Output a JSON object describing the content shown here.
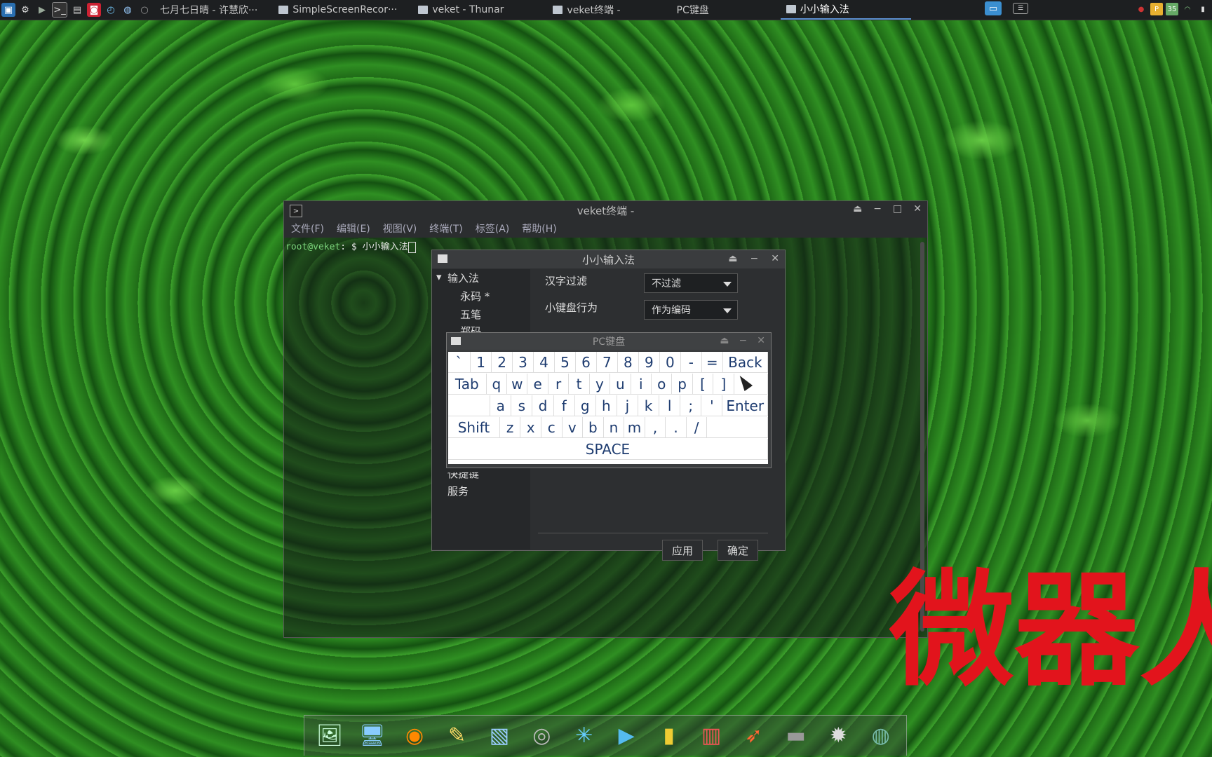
{
  "taskbar": {
    "launcher_icons": [
      "app-menu-icon",
      "settings-icon",
      "play-icon",
      "terminal-icon",
      "floppy-icon",
      "screen-icon",
      "clock-icon",
      "globe-icon"
    ],
    "tasks": [
      {
        "label": "七月七日晴 - 许慧欣···",
        "active": false
      },
      {
        "label": "SimpleScreenRecor···",
        "active": false
      },
      {
        "label": "veket - Thunar",
        "active": false
      },
      {
        "label": "veket终端 -",
        "active": false
      },
      {
        "label": "PC键盘",
        "active": false
      },
      {
        "label": "小小输入法",
        "active": true
      }
    ],
    "battery": "35"
  },
  "terminal": {
    "title": "veket终端 -",
    "menu": [
      "文件(F)",
      "编辑(E)",
      "视图(V)",
      "终端(T)",
      "标签(A)",
      "帮助(H)"
    ],
    "prompt_user": "root@veket",
    "prompt_rest": ": $ 小小输入法"
  },
  "ime": {
    "title": "小小输入法",
    "tree": {
      "root": "输入法",
      "items": [
        "永码 *",
        "五笔",
        "郑码"
      ],
      "bottom_partial": "快捷键",
      "bottom": "服务"
    },
    "settings": [
      {
        "label": "汉字过滤",
        "value": "不过滤"
      },
      {
        "label": "小键盘行为",
        "value": "作为编码"
      }
    ],
    "apply_label": "应用",
    "ok_label": "确定"
  },
  "keyboard": {
    "title": "PC键盘",
    "rows": [
      [
        "`",
        "1",
        "2",
        "3",
        "4",
        "5",
        "6",
        "7",
        "8",
        "9",
        "0",
        "-",
        "=",
        "Back"
      ],
      [
        "Tab",
        "q",
        "w",
        "e",
        "r",
        "t",
        "y",
        "u",
        "i",
        "o",
        "p",
        "[",
        "]",
        ""
      ],
      [
        "",
        "a",
        "s",
        "d",
        "f",
        "g",
        "h",
        "j",
        "k",
        "l",
        ";",
        "'",
        "Enter"
      ],
      [
        "Shift",
        "z",
        "x",
        "c",
        "v",
        "b",
        "n",
        "m",
        ",",
        ".",
        "/",
        ""
      ],
      [
        "SPACE"
      ]
    ]
  },
  "overlay_text": "微器人",
  "dock": {
    "items": [
      "image-viewer-icon",
      "monitor-icon",
      "firefox-icon",
      "text-editor-icon",
      "photo-icon",
      "disc-icon",
      "network-icon",
      "media-player-icon",
      "file-manager-icon",
      "presentation-icon",
      "rocket-icon",
      "printer-icon",
      "sun-icon",
      "globe-icon"
    ]
  }
}
